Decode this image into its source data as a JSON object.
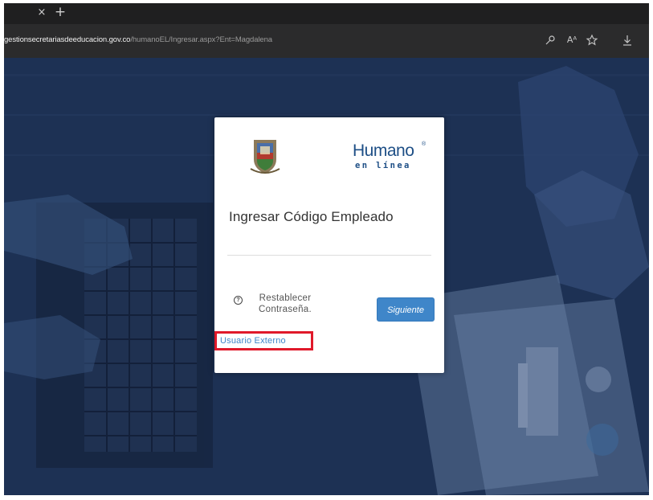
{
  "browser": {
    "tab_close_glyph": "×",
    "new_tab_glyph": "+",
    "url_host": "gestionsecretariasdeeducacion.gov.co",
    "url_path": "/humanoEL/Ingresar.aspx?Ent=Magdalena",
    "icons": [
      "key-icon",
      "read-aloud-icon",
      "favorite-star-icon",
      "download-icon"
    ],
    "read_aloud_label": "Aᴬ"
  },
  "login": {
    "brand_main": "Humano",
    "brand_reg": "®",
    "brand_sub": "en línea",
    "title": "Ingresar Código Empleado",
    "help_glyph": "?",
    "reset_password": "Restablecer Contraseña.",
    "next_button": "Siguiente",
    "external_user": "Usuario Externo"
  },
  "colors": {
    "brand_blue": "#1e4f86",
    "button_blue": "#3f86c9",
    "highlight_red": "#e0192a",
    "page_overlay": "#1c2f52"
  }
}
